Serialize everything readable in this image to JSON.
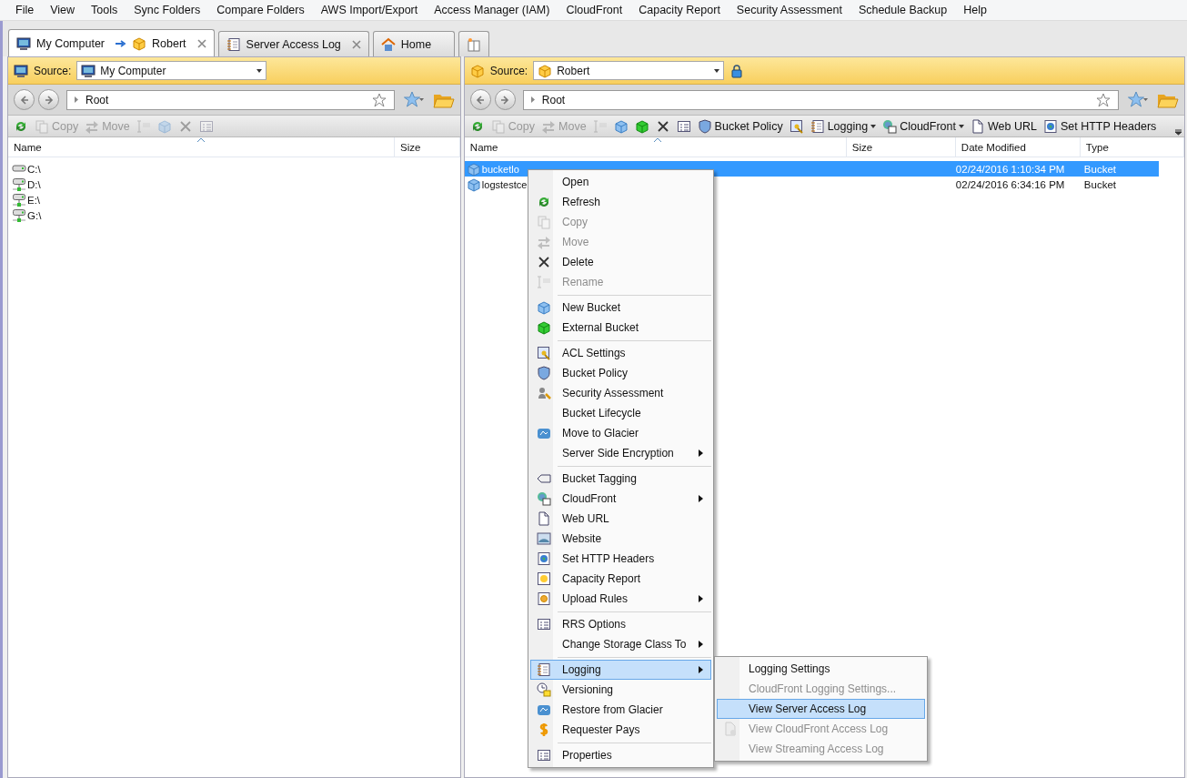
{
  "menu_bar": [
    "File",
    "View",
    "Tools",
    "Sync Folders",
    "Compare Folders",
    "AWS Import/Export",
    "Access Manager (IAM)",
    "CloudFront",
    "Capacity Report",
    "Security Assessment",
    "Schedule Backup",
    "Help"
  ],
  "tabs": [
    {
      "label": "My Computer",
      "target": "Robert",
      "selected": true,
      "closable": true
    },
    {
      "label": "Server Access Log",
      "selected": false,
      "closable": true
    },
    {
      "label": "Home",
      "selected": false,
      "closable": false
    }
  ],
  "left_pane": {
    "source_label": "Source:",
    "source": "My Computer",
    "path": "Root",
    "toolbar": [
      {
        "kind": "refresh",
        "disabled": false
      },
      {
        "kind": "copy",
        "label": "Copy",
        "disabled": true
      },
      {
        "kind": "move",
        "label": "Move",
        "disabled": true
      },
      {
        "kind": "rename",
        "disabled": true
      },
      {
        "kind": "cube",
        "disabled": true
      },
      {
        "kind": "delete",
        "disabled": true
      },
      {
        "kind": "props",
        "disabled": true
      }
    ],
    "columns": [
      "Name",
      "Size"
    ],
    "rows": [
      {
        "name": "C:\\",
        "kind": "local"
      },
      {
        "name": "D:\\",
        "kind": "network"
      },
      {
        "name": "E:\\",
        "kind": "network"
      },
      {
        "name": "G:\\",
        "kind": "network"
      }
    ]
  },
  "right_pane": {
    "source_label": "Source:",
    "source": "Robert",
    "locked": true,
    "path": "Root",
    "toolbar": [
      {
        "kind": "refresh",
        "disabled": false
      },
      {
        "kind": "copy",
        "label": "Copy",
        "disabled": true
      },
      {
        "kind": "move",
        "label": "Move",
        "disabled": true
      },
      {
        "kind": "rename",
        "disabled": true
      },
      {
        "kind": "cube",
        "disabled": false
      },
      {
        "kind": "cubeg",
        "disabled": false
      },
      {
        "kind": "delete",
        "disabled": false
      },
      {
        "kind": "props",
        "disabled": false
      },
      {
        "kind": "shield",
        "label": "Bucket Policy",
        "disabled": false
      },
      {
        "kind": "acl",
        "disabled": false
      },
      {
        "kind": "notebook",
        "label": "Logging",
        "disabled": false,
        "dropdown": true
      },
      {
        "kind": "cloud",
        "label": "CloudFront",
        "disabled": false,
        "dropdown": true
      },
      {
        "kind": "doc",
        "label": "Web URL",
        "disabled": false
      },
      {
        "kind": "globe",
        "label": "Set HTTP Headers",
        "disabled": false
      }
    ],
    "columns": [
      "Name",
      "Size",
      "Date Modified",
      "Type"
    ],
    "rows": [
      {
        "name": "bucketlo",
        "date": "02/24/2016 1:10:34 PM",
        "type": "Bucket",
        "selected": true
      },
      {
        "name": "logstestce",
        "date": "02/24/2016 6:34:16 PM",
        "type": "Bucket",
        "selected": false
      }
    ]
  },
  "context_menu": [
    {
      "kind": "item",
      "label": "Open",
      "disabled": false
    },
    {
      "kind": "item",
      "label": "Refresh",
      "disabled": false
    },
    {
      "kind": "item",
      "label": "Copy",
      "disabled": true
    },
    {
      "kind": "item",
      "label": "Move",
      "disabled": true
    },
    {
      "kind": "item",
      "label": "Delete",
      "disabled": false
    },
    {
      "kind": "item",
      "label": "Rename",
      "disabled": true
    },
    {
      "kind": "separator"
    },
    {
      "kind": "item",
      "label": "New Bucket",
      "disabled": false
    },
    {
      "kind": "item",
      "label": "External Bucket",
      "disabled": false
    },
    {
      "kind": "separator"
    },
    {
      "kind": "item",
      "label": "ACL Settings",
      "disabled": false
    },
    {
      "kind": "item",
      "label": "Bucket Policy",
      "disabled": false
    },
    {
      "kind": "item",
      "label": "Security Assessment",
      "disabled": false
    },
    {
      "kind": "item",
      "label": "Bucket Lifecycle",
      "disabled": false
    },
    {
      "kind": "item",
      "label": "Move to Glacier",
      "disabled": false
    },
    {
      "kind": "item",
      "label": "Server Side Encryption",
      "disabled": false,
      "submenu": true
    },
    {
      "kind": "separator"
    },
    {
      "kind": "item",
      "label": "Bucket Tagging",
      "disabled": false
    },
    {
      "kind": "item",
      "label": "CloudFront",
      "disabled": false,
      "submenu": true
    },
    {
      "kind": "item",
      "label": "Web URL",
      "disabled": false
    },
    {
      "kind": "item",
      "label": "Website",
      "disabled": false
    },
    {
      "kind": "item",
      "label": "Set HTTP Headers",
      "disabled": false
    },
    {
      "kind": "item",
      "label": "Capacity Report",
      "disabled": false
    },
    {
      "kind": "item",
      "label": "Upload Rules",
      "disabled": false,
      "submenu": true
    },
    {
      "kind": "separator"
    },
    {
      "kind": "item",
      "label": "RRS Options",
      "disabled": false
    },
    {
      "kind": "item",
      "label": "Change Storage Class To",
      "disabled": false,
      "submenu": true
    },
    {
      "kind": "separator"
    },
    {
      "kind": "item",
      "label": "Logging",
      "disabled": false,
      "submenu": true,
      "selected": true
    },
    {
      "kind": "item",
      "label": "Versioning",
      "disabled": false
    },
    {
      "kind": "item",
      "label": "Restore from Glacier",
      "disabled": false
    },
    {
      "kind": "item",
      "label": "Requester Pays",
      "disabled": false
    },
    {
      "kind": "separator"
    },
    {
      "kind": "item",
      "label": "Properties",
      "disabled": false
    }
  ],
  "logging_submenu": [
    {
      "label": "Logging Settings",
      "disabled": false,
      "selected": false
    },
    {
      "label": "CloudFront Logging Settings...",
      "disabled": true,
      "selected": false
    },
    {
      "label": "View Server Access Log",
      "disabled": false,
      "selected": true
    },
    {
      "label": "View CloudFront Access Log",
      "disabled": true,
      "selected": false
    },
    {
      "label": "View Streaming Access Log",
      "disabled": true,
      "selected": false
    }
  ]
}
